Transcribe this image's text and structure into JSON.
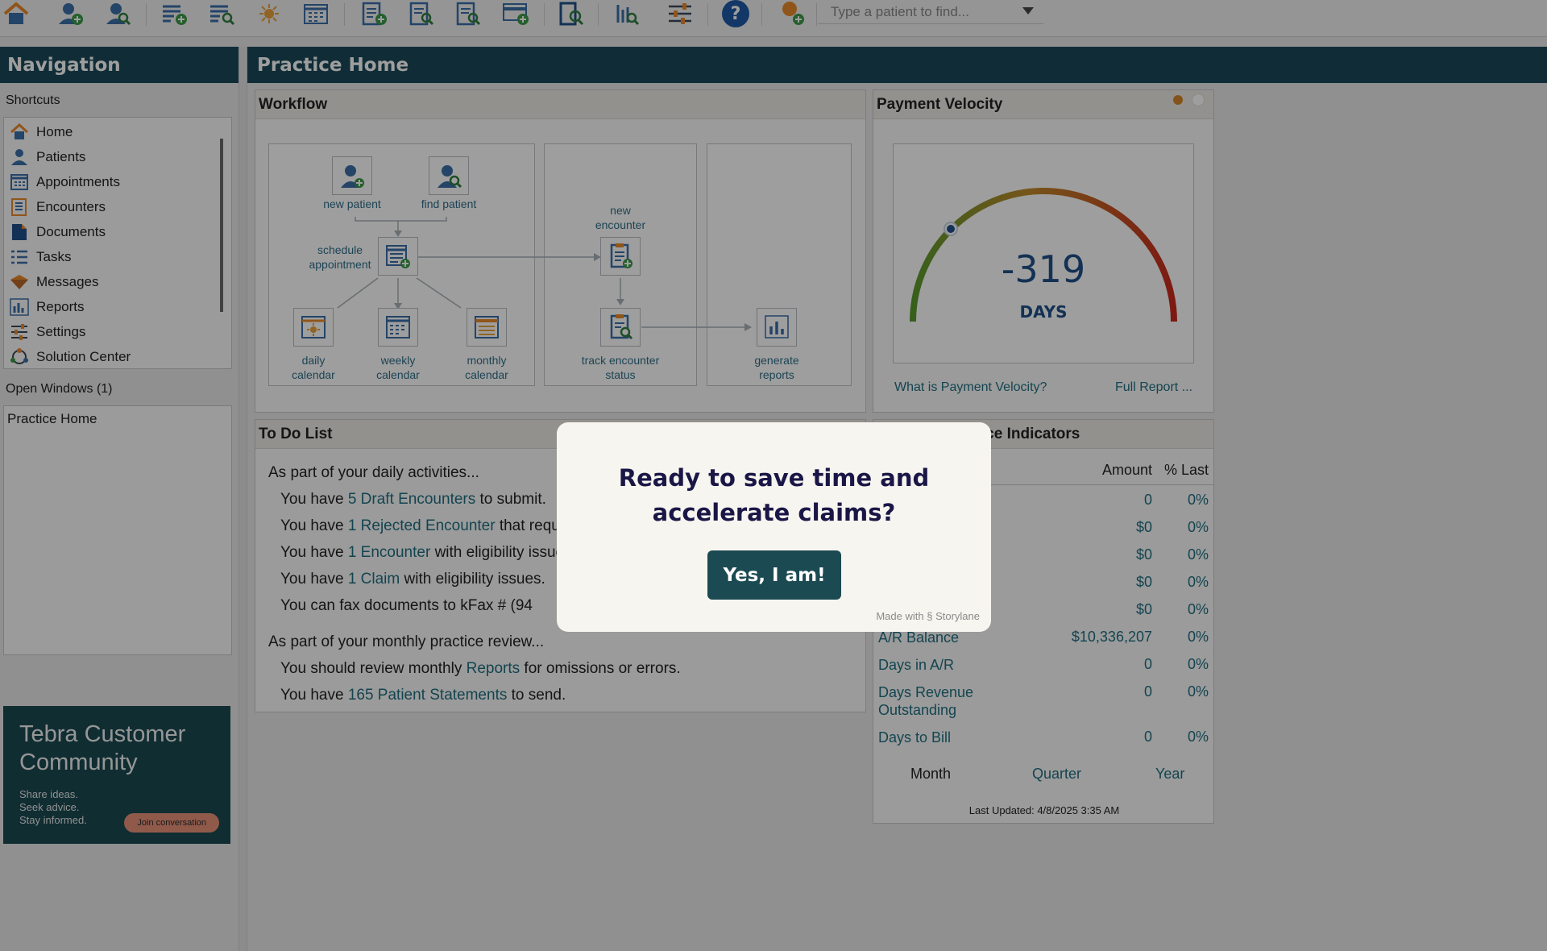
{
  "toolbar": {
    "icons": [
      "home-icon",
      "new-patient-icon",
      "find-patient-icon",
      "new-appointment-icon",
      "find-appointment-icon",
      "daily-calendar-icon",
      "monthly-calendar-icon",
      "new-encounter-icon",
      "find-encounter-icon",
      "find-claim-icon",
      "new-batch-icon",
      "document-search-icon",
      "report-search-icon",
      "settings-sliders-icon",
      "help-icon",
      "new-message-icon"
    ],
    "help_label": "?",
    "search_placeholder": "Type a patient to find..."
  },
  "nav": {
    "title": "Navigation",
    "shortcuts_label": "Shortcuts",
    "shortcuts": [
      {
        "label": "Home",
        "icon": "home-icon"
      },
      {
        "label": "Patients",
        "icon": "patient-icon"
      },
      {
        "label": "Appointments",
        "icon": "calendar-icon"
      },
      {
        "label": "Encounters",
        "icon": "encounter-icon"
      },
      {
        "label": "Documents",
        "icon": "document-icon"
      },
      {
        "label": "Tasks",
        "icon": "tasks-icon"
      },
      {
        "label": "Messages",
        "icon": "messages-icon"
      },
      {
        "label": "Reports",
        "icon": "reports-icon"
      },
      {
        "label": "Settings",
        "icon": "settings-icon"
      },
      {
        "label": "Solution Center",
        "icon": "solution-center-icon"
      }
    ],
    "open_windows_label": "Open Windows (1)",
    "open_windows": [
      "Practice Home"
    ],
    "promo": {
      "title": "Tebra Customer Community",
      "sub": [
        "Share ideas.",
        "Seek advice.",
        "Stay informed."
      ],
      "button": "Join conversation"
    }
  },
  "main": {
    "title": "Practice Home",
    "workflow": {
      "title": "Workflow",
      "labels": {
        "new_patient": "new patient",
        "find_patient": "find patient",
        "schedule": [
          "schedule",
          "appointment"
        ],
        "daily": [
          "daily",
          "calendar"
        ],
        "weekly": [
          "weekly",
          "calendar"
        ],
        "monthly": [
          "monthly",
          "calendar"
        ],
        "new_encounter": [
          "new",
          "encounter"
        ],
        "track": [
          "track encounter",
          "status"
        ],
        "reports": [
          "generate",
          "reports"
        ]
      }
    },
    "velocity": {
      "title": "Payment Velocity",
      "value": "-319",
      "unit": "DAYS",
      "link_what": "What is Payment Velocity?",
      "link_full": "Full Report ...",
      "gauge_colors": [
        "#5a9a2e",
        "#d48a1e",
        "#c82a1e"
      ],
      "dot_color": "#d5862a"
    },
    "todo": {
      "title": "To Do List",
      "daily_intro": "As part of your daily activities...",
      "daily": [
        {
          "pre": "You have ",
          "link": "5 Draft Encounters",
          "post": " to submit."
        },
        {
          "pre": "You have ",
          "link": "1 Rejected Encounter",
          "post": " that requires action."
        },
        {
          "pre": "You have ",
          "link": "1 Encounter",
          "post": " with eligibility issues."
        },
        {
          "pre": "You have ",
          "link": "1 Claim",
          "post": " with eligibility issues."
        },
        {
          "pre": "You can fax documents to kFax # (94",
          "link": "",
          "post": ""
        }
      ],
      "monthly_intro": "As part of your monthly practice review...",
      "monthly": [
        {
          "pre": "You should review monthly ",
          "link": "Reports",
          "post": " for omissions or errors."
        },
        {
          "pre": "You have ",
          "link": "165 Patient Statements",
          "post": " to send."
        }
      ]
    },
    "kpi": {
      "title": "Key Performance Indicators",
      "col_amount": "Amount",
      "col_last": "% Last",
      "rows": [
        {
          "name": "",
          "amount": "0",
          "last": "0%"
        },
        {
          "name": "",
          "amount": "$0",
          "last": "0%"
        },
        {
          "name": "",
          "amount": "$0",
          "last": "0%"
        },
        {
          "name": "",
          "amount": "$0",
          "last": "0%"
        },
        {
          "name": "",
          "amount": "$0",
          "last": "0%"
        },
        {
          "name": "A/R Balance",
          "amount": "$10,336,207",
          "last": "0%"
        },
        {
          "name": "Days in A/R",
          "amount": "0",
          "last": "0%"
        },
        {
          "name": "Days Revenue Outstanding",
          "amount": "0",
          "last": "0%"
        },
        {
          "name": "Days to Bill",
          "amount": "0",
          "last": "0%"
        }
      ],
      "periods": [
        "Month",
        "Quarter",
        "Year"
      ],
      "updated": "Last Updated: 4/8/2025 3:35 AM"
    }
  },
  "modal": {
    "title_line1": "Ready to save time and",
    "title_line2": "accelerate claims?",
    "button": "Yes, I am!",
    "footer": "Made with",
    "brand": "Storylane"
  }
}
